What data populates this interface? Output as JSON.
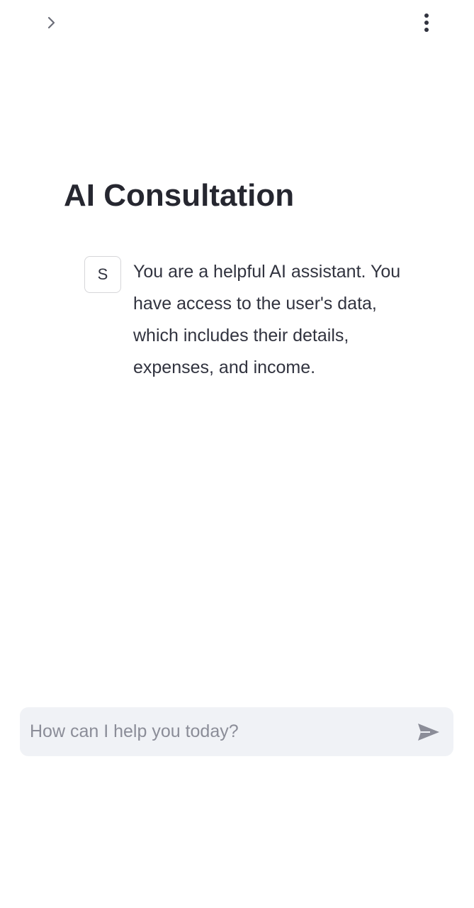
{
  "header": {
    "sidebar_toggle_icon": "chevron-right-icon",
    "menu_icon": "vertical-ellipsis-icon"
  },
  "main": {
    "title": "AI Consultation",
    "messages": [
      {
        "avatar_letter": "S",
        "text": "You are a helpful AI assistant. You have access to the user's data, which includes their details, expenses, and income."
      }
    ]
  },
  "chat_input": {
    "placeholder": "How can I help you today?",
    "value": "",
    "send_icon": "send-icon"
  },
  "colors": {
    "title": "#262730",
    "text": "#31333f",
    "input_background": "#f0f2f6",
    "placeholder": "#8b8d98",
    "icon": "#8b8d98"
  }
}
